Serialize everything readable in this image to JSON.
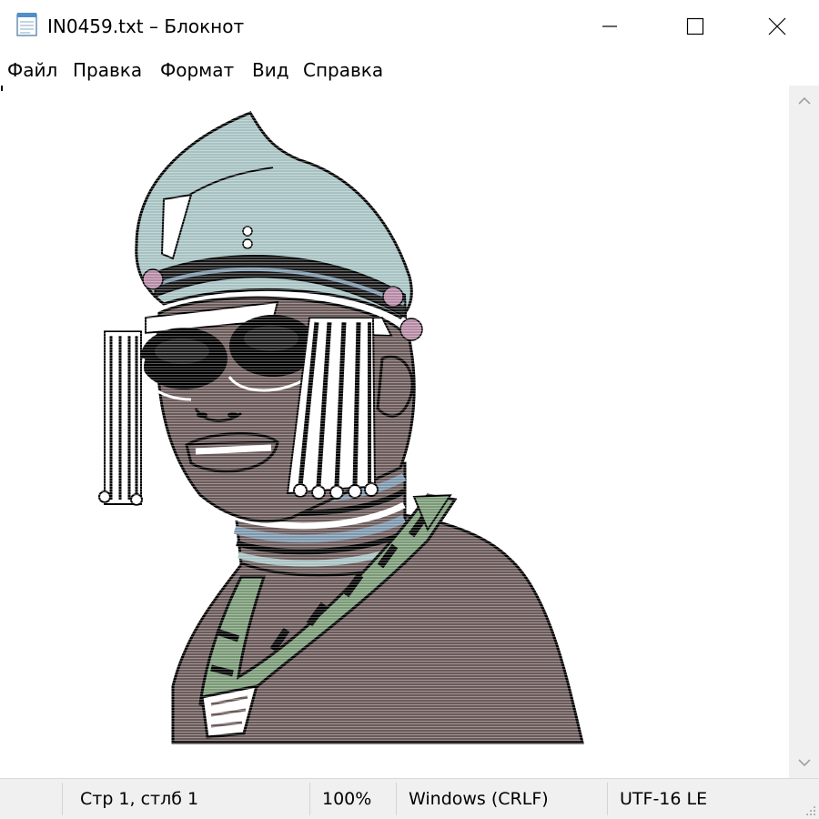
{
  "window": {
    "title": "IN0459.txt – Блокнот",
    "app_icon": "notepad-icon",
    "controls": [
      "minimize-icon",
      "maximize-icon",
      "close-icon"
    ]
  },
  "menu": {
    "file": "Файл",
    "edit": "Правка",
    "format": "Формат",
    "view": "Вид",
    "help": "Справка"
  },
  "editor": {
    "content_description_icon": "ascii-art-portrait"
  },
  "scrollbar": {
    "up_icon": "scroll-up-arrow-icon",
    "down_icon": "scroll-down-arrow-icon"
  },
  "status": {
    "position": "Стр 1, стлб 1",
    "zoom": "100%",
    "line_endings": "Windows (CRLF)",
    "encoding": "UTF-16 LE"
  },
  "colors": {
    "skin": "#6b5a5a",
    "headwrap": "#a7c2c2",
    "beads_green": "#7a9a76",
    "accent_pink": "#b58aa5",
    "stripe_blue": "#7d97ad",
    "outline": "#000000",
    "status_bg": "#f0f0f0"
  }
}
